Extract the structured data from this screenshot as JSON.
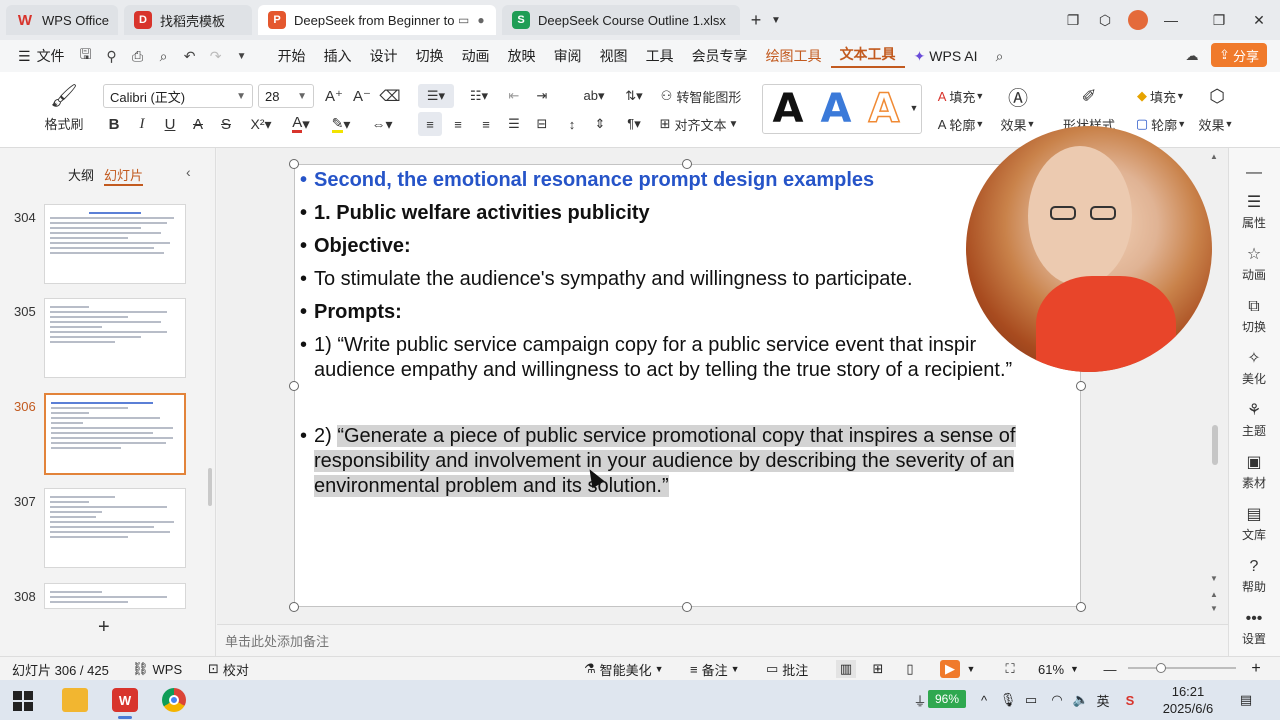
{
  "tabs": [
    {
      "label": "WPS Office",
      "icon": "wps-logo-icon",
      "color": "#d8342c"
    },
    {
      "label": "找稻壳模板",
      "icon": "docer-icon",
      "color": "#d8342c"
    },
    {
      "label": "DeepSeek from Beginner to",
      "icon": "ppt-file-icon",
      "color": "#e4572e"
    },
    {
      "label": "DeepSeek Course Outline 1.xlsx",
      "icon": "xlsx-file-icon",
      "color": "#1f9d55"
    }
  ],
  "menu": {
    "file": "文件",
    "items": [
      "开始",
      "插入",
      "设计",
      "切换",
      "动画",
      "放映",
      "审阅",
      "视图",
      "工具",
      "会员专享"
    ],
    "draw_tools": "绘图工具",
    "text_tools": "文本工具",
    "wps_ai": "WPS AI",
    "share": "分享"
  },
  "ribbon": {
    "format_painter": "格式刷",
    "font_name": "Calibri (正文)",
    "font_size": "28",
    "convert_smartart": "转智能图形",
    "align_text": "对齐文本",
    "fill_label": "填充",
    "outline_label": "轮廓",
    "effect_label": "效果",
    "shape_style": "形状样式",
    "fill2_label": "填充",
    "outline2_label": "轮廓",
    "effect2_label": "效果",
    "wordart_letter": "A"
  },
  "left_panel": {
    "outline_tab": "大纲",
    "slides_tab": "幻灯片",
    "thumb_numbers": [
      "304",
      "305",
      "306",
      "307",
      "308"
    ],
    "add_slide": "+"
  },
  "slide": {
    "line1": "Second, the emotional resonance prompt design examples",
    "line2": "1. Public welfare activities publicity",
    "line3": "Objective:",
    "line4": "To stimulate the audience's sympathy and willingness to participate.",
    "line5": "Prompts:",
    "p1_a": "1) “Write public service campaign copy for a public service event that inspir",
    "p1_b": "audience empathy and willingness to act by telling the true story of a recipient.”",
    "p2_prefix": "2) ",
    "p2_a": "“Generate a piece of public service promotional copy that inspires a sense of",
    "p2_b": "responsibility and involvement in your audience by describing the severity of an",
    "p2_c": "environmental problem and its solution.”",
    "bullet": "•"
  },
  "notes_placeholder": "单击此处添加备注",
  "right_bar": [
    "属性",
    "动画",
    "切换",
    "美化",
    "主题",
    "素材",
    "文库",
    "帮助",
    "设置"
  ],
  "status": {
    "slide_count": "幻灯片 306 / 425",
    "wps": "WPS",
    "proof": "校对",
    "smart_beautify": "智能美化",
    "notes": "备注",
    "comments": "批注",
    "zoom": "61%"
  },
  "taskbar": {
    "battery": "96%",
    "ime": "英",
    "time": "16:21",
    "date": "2025/6/6"
  },
  "colors": {
    "accent": "#c25a1f",
    "title_blue": "#2654c8",
    "share_orange": "#f07a2b"
  }
}
